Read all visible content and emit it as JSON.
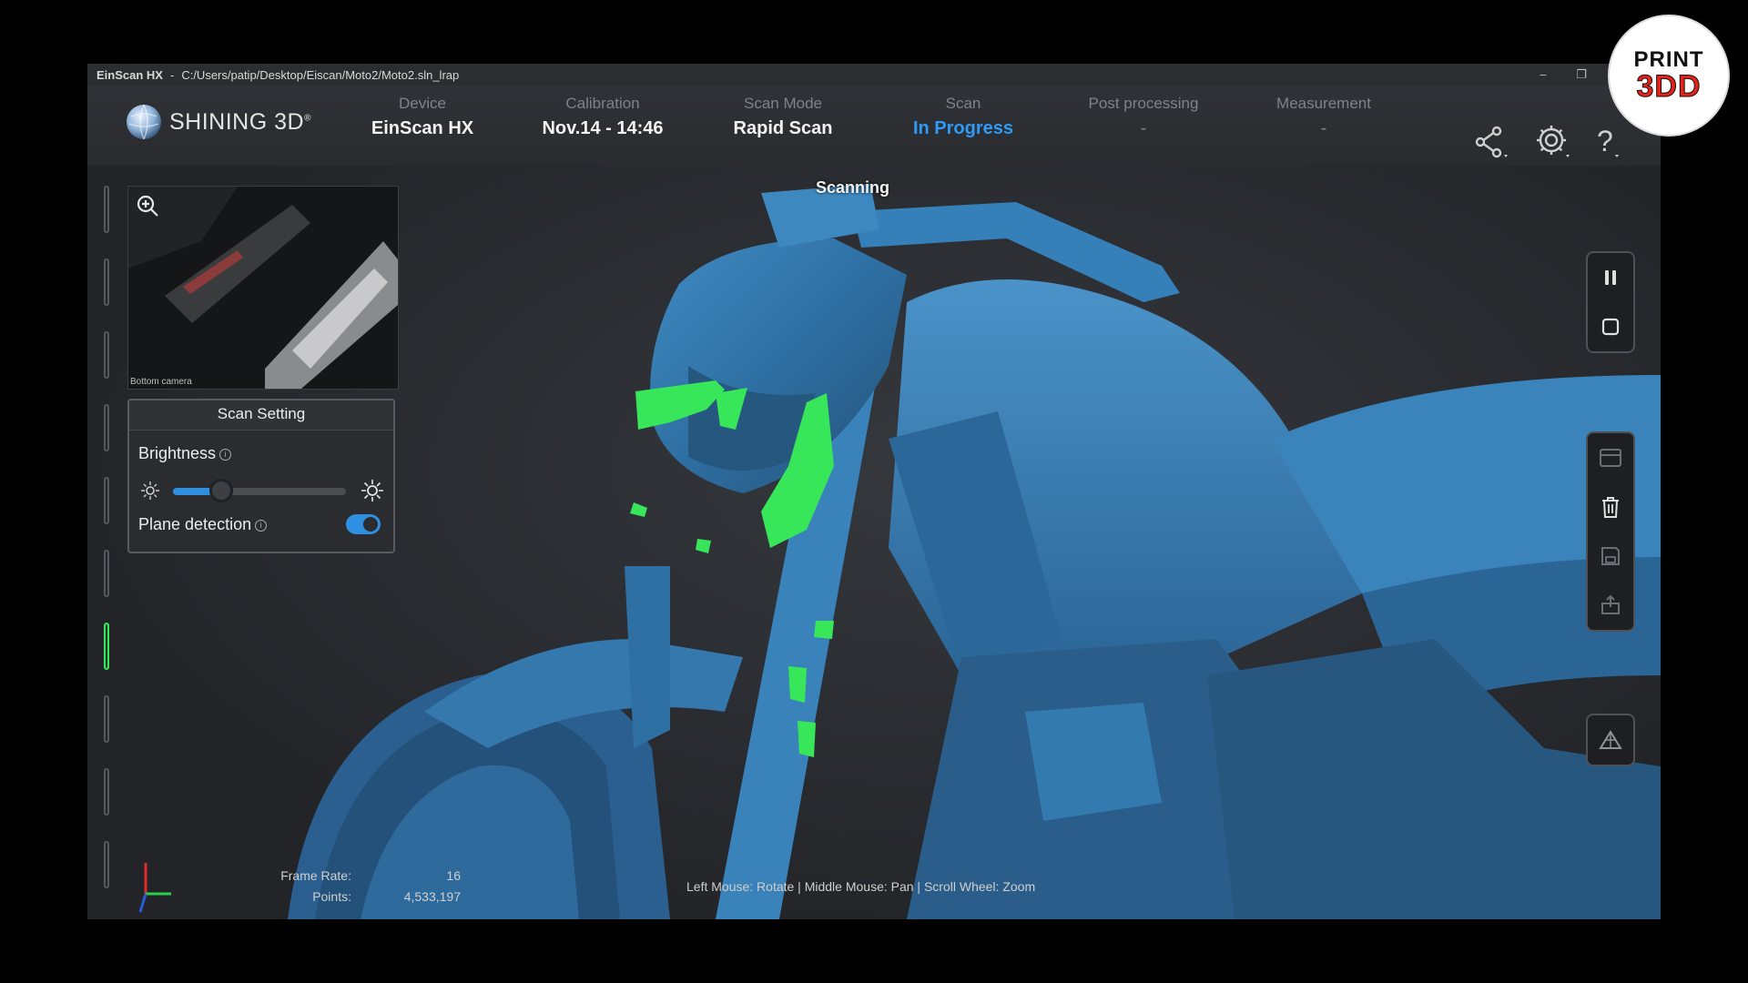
{
  "window": {
    "app_name": "EinScan HX",
    "path": "C:/Users/patip/Desktop/Eiscan/Moto2/Moto2.sln_lrap",
    "minimize": "–",
    "restore": "❐"
  },
  "brand": {
    "logo_text": "SHINING 3D",
    "logo_mark": "®"
  },
  "steps": [
    {
      "label": "Device",
      "value": "EinScan HX"
    },
    {
      "label": "Calibration",
      "value": "Nov.14 - 14:46"
    },
    {
      "label": "Scan Mode",
      "value": "Rapid Scan"
    },
    {
      "label": "Scan",
      "value": "In Progress"
    },
    {
      "label": "Post processing",
      "value": "-"
    },
    {
      "label": "Measurement",
      "value": "-"
    }
  ],
  "top_icons": [
    "share-icon",
    "gear-icon",
    "help-icon"
  ],
  "status": {
    "scanning": "Scanning"
  },
  "camera": {
    "label": "Bottom camera"
  },
  "scan_setting": {
    "title": "Scan Setting",
    "brightness_label": "Brightness",
    "brightness_level": 0.28,
    "plane_detection_label": "Plane detection",
    "plane_detection_on": true
  },
  "right_tools": {
    "group1": [
      "pause-icon",
      "stop-icon"
    ],
    "group2": [
      "panel-icon",
      "trash-icon",
      "save-icon",
      "export-icon"
    ],
    "group3": [
      "mesh-icon"
    ]
  },
  "stats": {
    "frame_rate_label": "Frame Rate:",
    "frame_rate_value": "16",
    "points_label": "Points:",
    "points_value": "4,533,197"
  },
  "hint": "Left Mouse: Rotate | Middle Mouse: Pan | Scroll Wheel: Zoom",
  "badge": {
    "line1": "PRINT",
    "line2": "3DD"
  },
  "colors": {
    "accent": "#2f9bf6",
    "scan_surface": "#2f74a8",
    "live_points": "#38e65a"
  }
}
